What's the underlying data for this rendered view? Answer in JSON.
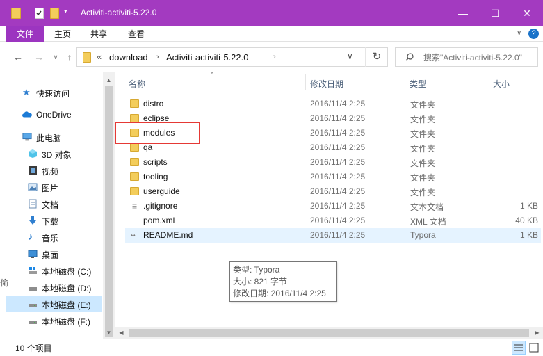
{
  "window": {
    "title": "Activiti-activiti-5.22.0",
    "controls": {
      "minimize": "—",
      "maximize": "☐",
      "close": "✕"
    }
  },
  "ribbon": {
    "tabs": [
      "文件",
      "主页",
      "共享",
      "查看"
    ],
    "help": "?"
  },
  "address": {
    "overflow": "«",
    "crumbs": [
      "download",
      "Activiti-activiti-5.22.0"
    ],
    "search_placeholder": "搜索\"Activiti-activiti-5.22.0\""
  },
  "nav": {
    "items": [
      {
        "label": "快速访问",
        "icon": "star-icon"
      },
      {
        "label": "OneDrive",
        "icon": "cloud-icon"
      },
      {
        "label": "此电脑",
        "icon": "computer-icon"
      },
      {
        "label": "3D 对象",
        "icon": "cube-icon"
      },
      {
        "label": "视频",
        "icon": "film-icon"
      },
      {
        "label": "图片",
        "icon": "picture-icon"
      },
      {
        "label": "文档",
        "icon": "document-icon"
      },
      {
        "label": "下载",
        "icon": "download-icon"
      },
      {
        "label": "音乐",
        "icon": "music-icon"
      },
      {
        "label": "桌面",
        "icon": "desktop-icon"
      },
      {
        "label": "本地磁盘 (C:)",
        "icon": "windows-drive-icon"
      },
      {
        "label": "本地磁盘 (D:)",
        "icon": "drive-icon"
      },
      {
        "label": "本地磁盘 (E:)",
        "icon": "drive-icon",
        "selected": true
      },
      {
        "label": "本地磁盘 (F:)",
        "icon": "drive-icon"
      }
    ]
  },
  "list": {
    "columns": {
      "name": "名称",
      "date": "修改日期",
      "type": "类型",
      "size": "大小"
    },
    "sort_indicator": "^",
    "files": [
      {
        "name": "distro",
        "date": "2016/11/4 2:25",
        "type": "文件夹",
        "size": "",
        "icon": "folder-icon"
      },
      {
        "name": "eclipse",
        "date": "2016/11/4 2:25",
        "type": "文件夹",
        "size": "",
        "icon": "folder-icon"
      },
      {
        "name": "modules",
        "date": "2016/11/4 2:25",
        "type": "文件夹",
        "size": "",
        "icon": "folder-icon"
      },
      {
        "name": "qa",
        "date": "2016/11/4 2:25",
        "type": "文件夹",
        "size": "",
        "icon": "folder-icon"
      },
      {
        "name": "scripts",
        "date": "2016/11/4 2:25",
        "type": "文件夹",
        "size": "",
        "icon": "folder-icon"
      },
      {
        "name": "tooling",
        "date": "2016/11/4 2:25",
        "type": "文件夹",
        "size": "",
        "icon": "folder-icon"
      },
      {
        "name": "userguide",
        "date": "2016/11/4 2:25",
        "type": "文件夹",
        "size": "",
        "icon": "folder-icon"
      },
      {
        "name": ".gitignore",
        "date": "2016/11/4 2:25",
        "type": "文本文档",
        "size": "1 KB",
        "icon": "text-file-icon"
      },
      {
        "name": "pom.xml",
        "date": "2016/11/4 2:25",
        "type": "XML 文档",
        "size": "40 KB",
        "icon": "xml-file-icon"
      },
      {
        "name": "README.md",
        "date": "2016/11/4 2:25",
        "type": "Typora",
        "size": "1 KB",
        "icon": "typora-file-icon",
        "hover": true
      }
    ]
  },
  "tooltip": {
    "type_line": "类型: Typora",
    "size_line": "大小: 821 字节",
    "date_line": "修改日期: 2016/11/4 2:25"
  },
  "status": {
    "count": "10 个项目"
  },
  "left_edge_glyph": "偷",
  "colors": {
    "titlebar": "#a33ac0",
    "file_tab": "#9c35c0",
    "selection": "#cce8ff",
    "hover": "#e5f3ff",
    "highlight_box": "#e53935"
  }
}
